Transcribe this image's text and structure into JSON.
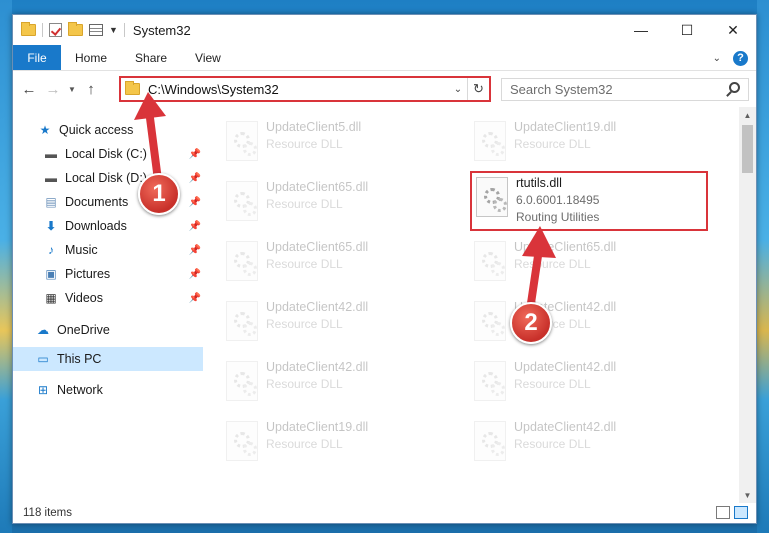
{
  "window": {
    "title": "System32",
    "minimize": "—",
    "maximize": "☐",
    "close": "✕"
  },
  "ribbon": {
    "tabs": [
      "File",
      "Home",
      "Share",
      "View"
    ],
    "help": "?"
  },
  "address": {
    "path": "C:\\Windows\\System32",
    "search_placeholder": "Search System32"
  },
  "sidebar": {
    "items": [
      {
        "label": "Quick access",
        "icon": "star-icon",
        "pinned": false
      },
      {
        "label": "Local Disk (C:)",
        "icon": "drive-icon",
        "pinned": true
      },
      {
        "label": "Local Disk (D:)",
        "icon": "drive-icon",
        "pinned": true
      },
      {
        "label": "Documents",
        "icon": "documents-icon",
        "pinned": true
      },
      {
        "label": "Downloads",
        "icon": "download-icon",
        "pinned": true
      },
      {
        "label": "Music",
        "icon": "music-icon",
        "pinned": true
      },
      {
        "label": "Pictures",
        "icon": "pictures-icon",
        "pinned": true
      },
      {
        "label": "Videos",
        "icon": "videos-icon",
        "pinned": true
      },
      {
        "label": "OneDrive",
        "icon": "cloud-icon",
        "pinned": false
      },
      {
        "label": "This PC",
        "icon": "computer-icon",
        "pinned": false,
        "selected": true
      },
      {
        "label": "Network",
        "icon": "network-icon",
        "pinned": false
      }
    ]
  },
  "files": [
    {
      "name": "UpdateClient5.dll",
      "sub": "Resource DLL",
      "faded": true
    },
    {
      "name": "UpdateClient19.dll",
      "sub": "Resource DLL",
      "faded": true
    },
    {
      "name": "UpdateClient65.dll",
      "sub": "Resource DLL",
      "faded": true
    },
    {
      "name": "rtutils.dll",
      "sub": "6.0.6001.18495",
      "sub2": "Routing Utilities",
      "faded": false,
      "highlighted": true
    },
    {
      "name": "UpdateClient65.dll",
      "sub": "Resource DLL",
      "faded": true
    },
    {
      "name": "UpdateClient65.dll",
      "sub": "Resource DLL",
      "faded": true
    },
    {
      "name": "UpdateClient42.dll",
      "sub": "Resource DLL",
      "faded": true
    },
    {
      "name": "UpdateClient42.dll",
      "sub": "Resource DLL",
      "faded": true
    },
    {
      "name": "UpdateClient42.dll",
      "sub": "Resource DLL",
      "faded": true
    },
    {
      "name": "UpdateClient42.dll",
      "sub": "Resource DLL",
      "faded": true
    },
    {
      "name": "UpdateClient19.dll",
      "sub": "Resource DLL",
      "faded": true
    },
    {
      "name": "UpdateClient42.dll",
      "sub": "Resource DLL",
      "faded": true
    }
  ],
  "status": {
    "item_count": "118 items"
  },
  "callouts": {
    "step1": "1",
    "step2": "2"
  },
  "colors": {
    "accent": "#1979ca",
    "highlight_red": "#d9343a",
    "selected_bg": "#cce8ff"
  }
}
